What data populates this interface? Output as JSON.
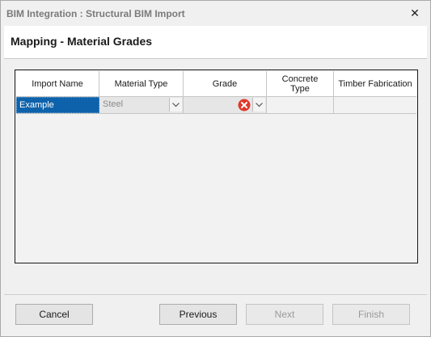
{
  "window": {
    "title": "BIM Integration : Structural BIM Import",
    "close_glyph": "✕"
  },
  "page": {
    "title": "Mapping - Material Grades"
  },
  "grid": {
    "columns": [
      {
        "label": "Import Name"
      },
      {
        "label": "Material Type"
      },
      {
        "label": "Grade"
      },
      {
        "label": "Concrete Type"
      },
      {
        "label": "Timber Fabrication"
      }
    ],
    "rows": [
      {
        "import_name": "Example",
        "material_type": "Steel",
        "grade": "",
        "concrete_type": "",
        "timber_fabrication": ""
      }
    ]
  },
  "icons": {
    "close": "close-icon",
    "dropdown": "chevron-down-icon",
    "error": "error-icon"
  },
  "colors": {
    "selection": "#0d62ab",
    "error": "#e0392b"
  },
  "buttons": {
    "cancel": "Cancel",
    "previous": "Previous",
    "next": "Next",
    "finish": "Finish"
  }
}
